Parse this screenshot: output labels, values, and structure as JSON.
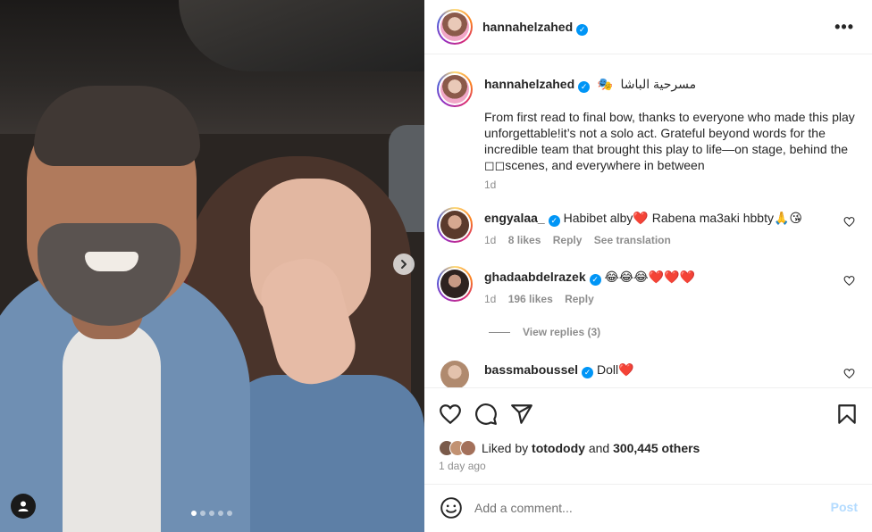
{
  "post": {
    "author": "hannahelzahed",
    "verified_mark": "✓",
    "caption_title": "مسرحية الباشا",
    "caption_emoji": "🎭",
    "caption_text": "From first read to final bow, thanks to everyone who made this play unforgettable!it’s not a solo act. Grateful beyond words for the incredible team that brought this play to life—on stage, behind the ◻◻scenes, and everywhere in between",
    "caption_time": "1d",
    "more_icon": "•••"
  },
  "comments": [
    {
      "username": "engyalaa_",
      "text": "Habibet alby❤️  Rabena ma3aki hbbty🙏😘",
      "time": "1d",
      "likes": "8 likes",
      "reply": "Reply",
      "translate": "See translation"
    },
    {
      "username": "ghadaabdelrazek",
      "text": "😂😂😂❤️❤️❤️",
      "time": "1d",
      "likes": "196 likes",
      "reply": "Reply",
      "view_replies": "View replies (3)"
    },
    {
      "username": "bassmaboussel",
      "text": "Doll❤️"
    }
  ],
  "actions": {
    "liked_by_prefix": "Liked by",
    "liked_by_user": "totodody",
    "liked_by_and": "and",
    "liked_by_others": "300,445 others",
    "date": "1 day ago"
  },
  "comment_box": {
    "placeholder": "Add a comment...",
    "post_label": "Post"
  },
  "carousel": {
    "slide_count": 5,
    "active_index": 0
  },
  "colors": {
    "accent": "#0095f6",
    "heart": "#ed4956",
    "muted": "#8e8e8e",
    "post_disabled": "#b3dbff"
  },
  "icons": [
    "next-arrow-icon",
    "user-tag-icon",
    "heart-icon",
    "comment-icon",
    "share-icon",
    "bookmark-icon",
    "emoji-icon",
    "more-icon",
    "verified-icon"
  ]
}
